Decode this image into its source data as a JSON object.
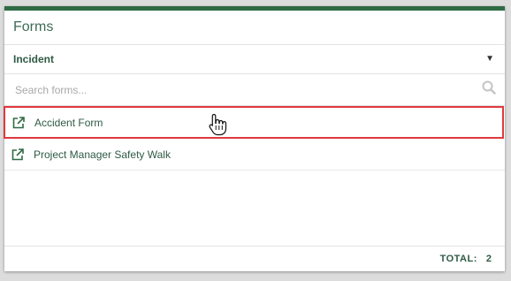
{
  "panel": {
    "title": "Forms"
  },
  "category_select": {
    "selected": "Incident",
    "icon": "caret-down-icon"
  },
  "search": {
    "placeholder": "Search forms...",
    "value": "",
    "icon": "search-icon"
  },
  "forms": [
    {
      "label": "Accident Form",
      "icon": "external-link-icon",
      "highlighted": true
    },
    {
      "label": "Project Manager Safety Walk",
      "icon": "external-link-icon",
      "highlighted": false
    }
  ],
  "footer": {
    "total_label": "TOTAL:",
    "total_value": "2"
  },
  "colors": {
    "accent": "#2f6b45",
    "text_green": "#2f5b45",
    "highlight_border": "#e0393e"
  }
}
